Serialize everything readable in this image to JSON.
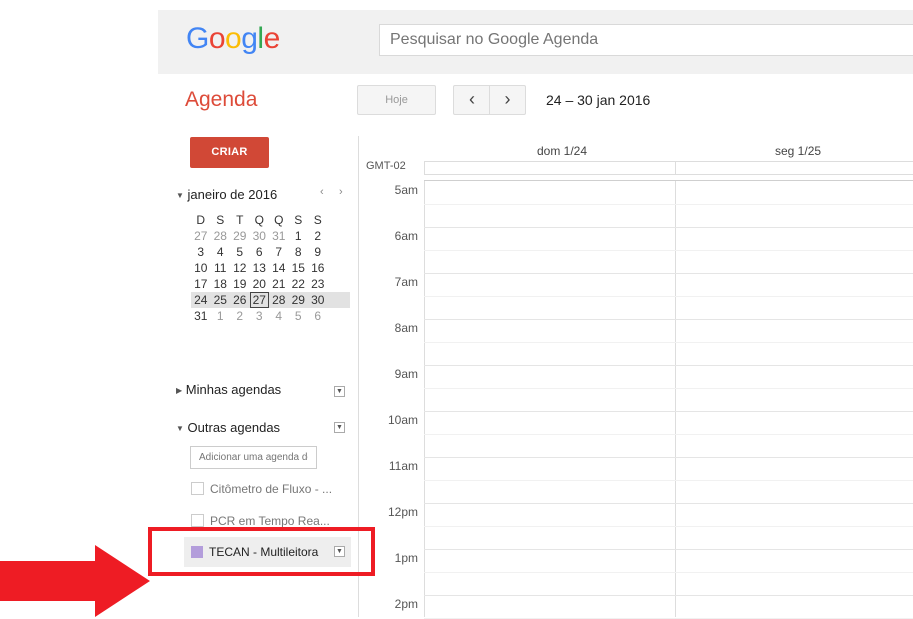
{
  "header": {
    "logo_letters": [
      "G",
      "o",
      "o",
      "g",
      "l",
      "e"
    ],
    "logo_colors": [
      "#4285f4",
      "#ea4335",
      "#fbbc05",
      "#4285f4",
      "#34a853",
      "#ea4335"
    ],
    "search_placeholder": "Pesquisar no Google Agenda"
  },
  "toolbar": {
    "app_title": "Agenda",
    "today_label": "Hoje",
    "prev_label": "‹",
    "next_label": "›",
    "date_range": "24 – 30 jan 2016"
  },
  "sidebar": {
    "create_label": "CRIAR",
    "mini_calendar": {
      "month_label": "janeiro de 2016",
      "prev": "‹",
      "next": "›",
      "weekday_headers": [
        "D",
        "S",
        "T",
        "Q",
        "Q",
        "S",
        "S"
      ],
      "weeks": [
        [
          "27",
          "28",
          "29",
          "30",
          "31",
          "1",
          "2"
        ],
        [
          "3",
          "4",
          "5",
          "6",
          "7",
          "8",
          "9"
        ],
        [
          "10",
          "11",
          "12",
          "13",
          "14",
          "15",
          "16"
        ],
        [
          "17",
          "18",
          "19",
          "20",
          "21",
          "22",
          "23"
        ],
        [
          "24",
          "25",
          "26",
          "27",
          "28",
          "29",
          "30"
        ],
        [
          "31",
          "1",
          "2",
          "3",
          "4",
          "5",
          "6"
        ]
      ],
      "selected_week_index": 4,
      "today": "27"
    },
    "my_calendars_label": "Minhas agendas",
    "other_calendars_label": "Outras agendas",
    "add_calendar_placeholder": "Adicionar uma agenda de um amigo",
    "other_calendars": [
      {
        "label": "Citômetro de Fluxo - ..."
      },
      {
        "label": "PCR em Tempo Rea..."
      }
    ],
    "highlighted_calendar": {
      "label": "TECAN - Multileitora",
      "color": "#b39ddb"
    }
  },
  "calendar": {
    "timezone": "GMT-02",
    "days": [
      "dom 1/24",
      "seg 1/25"
    ],
    "hours": [
      "5am",
      "6am",
      "7am",
      "8am",
      "9am",
      "10am",
      "11am",
      "12pm",
      "1pm",
      "2pm"
    ]
  },
  "annotation": {
    "color": "#ee1c24"
  }
}
